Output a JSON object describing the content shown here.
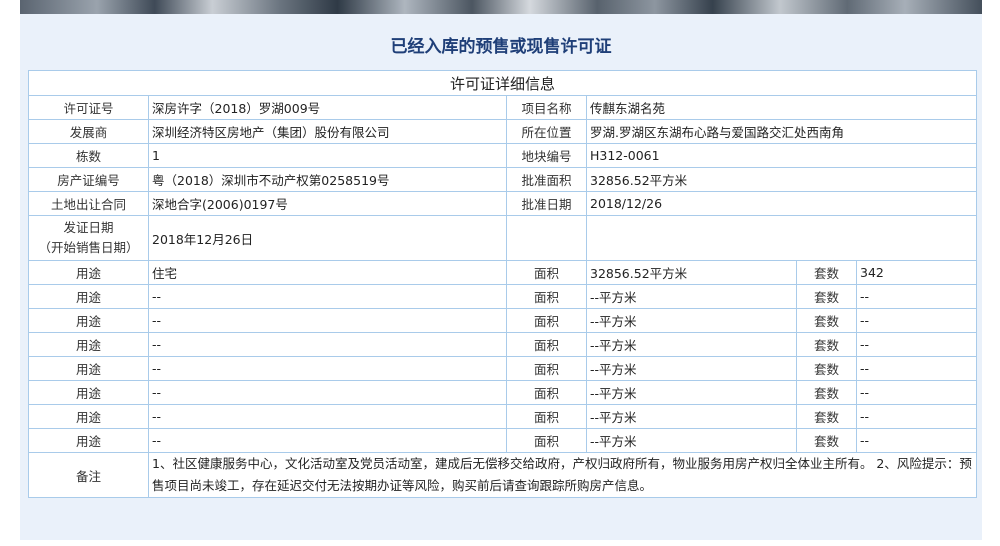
{
  "page_title": "已经入库的预售或现售许可证",
  "table_caption": "许可证详细信息",
  "fields": {
    "permit_no": {
      "label": "许可证号",
      "value": "深房许字（2018）罗湖009号"
    },
    "project_name": {
      "label": "项目名称",
      "value": "传麒东湖名苑"
    },
    "developer": {
      "label": "发展商",
      "value": "深圳经济特区房地产（集团）股份有限公司"
    },
    "location": {
      "label": "所在位置",
      "value": "罗湖.罗湖区东湖布心路与爱国路交汇处西南角"
    },
    "buildings": {
      "label": "栋数",
      "value": "1"
    },
    "plot_no": {
      "label": "地块编号",
      "value": "H312-0061"
    },
    "property_cert": {
      "label": "房产证编号",
      "value": "粤（2018）深圳市不动产权第0258519号"
    },
    "approved_area": {
      "label": "批准面积",
      "value": "32856.52平方米"
    },
    "land_contract": {
      "label": "土地出让合同",
      "value": "深地合字(2006)0197号"
    },
    "approval_date": {
      "label": "批准日期",
      "value": "2018/12/26"
    },
    "issue_date": {
      "label_line1": "发证日期",
      "label_line2": "（开始销售日期）",
      "value": "2018年12月26日"
    }
  },
  "usage_labels": {
    "usage": "用途",
    "area": "面积",
    "units": "套数"
  },
  "usage_rows": [
    {
      "usage": "住宅",
      "area": "32856.52平方米",
      "units": "342"
    },
    {
      "usage": "--",
      "area": "--平方米",
      "units": "--"
    },
    {
      "usage": "--",
      "area": "--平方米",
      "units": "--"
    },
    {
      "usage": "--",
      "area": "--平方米",
      "units": "--"
    },
    {
      "usage": "--",
      "area": "--平方米",
      "units": "--"
    },
    {
      "usage": "--",
      "area": "--平方米",
      "units": "--"
    },
    {
      "usage": "--",
      "area": "--平方米",
      "units": "--"
    },
    {
      "usage": "--",
      "area": "--平方米",
      "units": "--"
    }
  ],
  "remarks": {
    "label": "备注",
    "text": "1、社区健康服务中心，文化活动室及党员活动室，建成后无偿移交给政府，产权归政府所有，物业服务用房产权归全体业主所有。 2、风险提示：预售项目尚未竣工，存在延迟交付无法按期办证等风险，购买前后请查询跟踪所购房产信息。"
  },
  "colors": {
    "title": "#1f3f78",
    "border": "#a9cbea",
    "panel": "#eaf1fa"
  }
}
